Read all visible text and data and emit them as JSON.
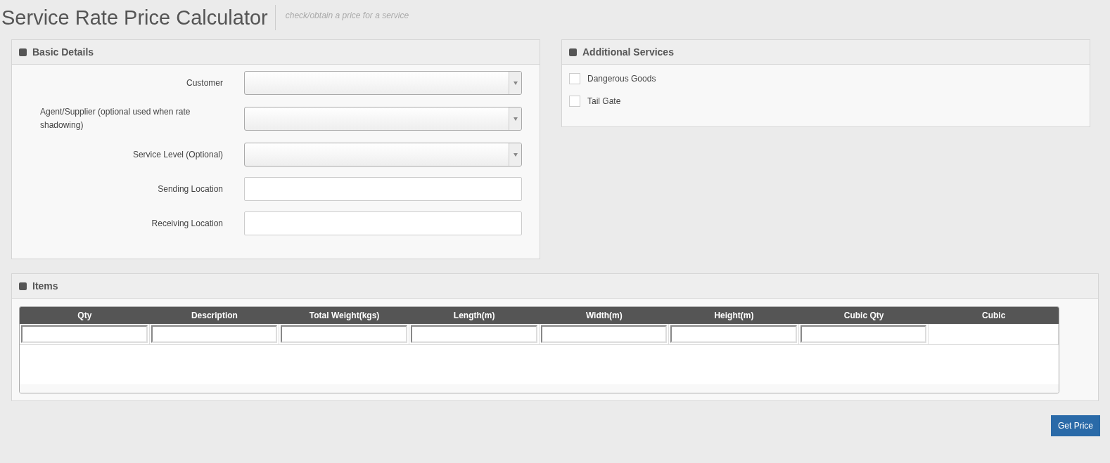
{
  "header": {
    "title": "Service Rate Price Calculator",
    "subtitle": "check/obtain a price for a service"
  },
  "basic_details": {
    "title": "Basic Details",
    "fields": [
      {
        "label": "Customer",
        "kind": "select"
      },
      {
        "label": "Agent/Supplier (optional used when rate shadowing)",
        "kind": "select"
      },
      {
        "label": "Service Level (Optional)",
        "kind": "select"
      },
      {
        "label": "Sending Location",
        "kind": "text"
      },
      {
        "label": "Receiving Location",
        "kind": "text"
      }
    ]
  },
  "additional_services": {
    "title": "Additional Services",
    "options": [
      {
        "label": "Dangerous Goods",
        "checked": false
      },
      {
        "label": "Tail Gate",
        "checked": false
      }
    ]
  },
  "items": {
    "title": "Items",
    "columns": [
      {
        "label": "Qty",
        "input": true
      },
      {
        "label": "Description",
        "input": true
      },
      {
        "label": "Total Weight(kgs)",
        "input": true
      },
      {
        "label": "Length(m)",
        "input": true
      },
      {
        "label": "Width(m)",
        "input": true
      },
      {
        "label": "Height(m)",
        "input": true
      },
      {
        "label": "Cubic Qty",
        "input": true
      },
      {
        "label": "Cubic",
        "input": false
      }
    ]
  },
  "button": {
    "label": "Get Price"
  }
}
